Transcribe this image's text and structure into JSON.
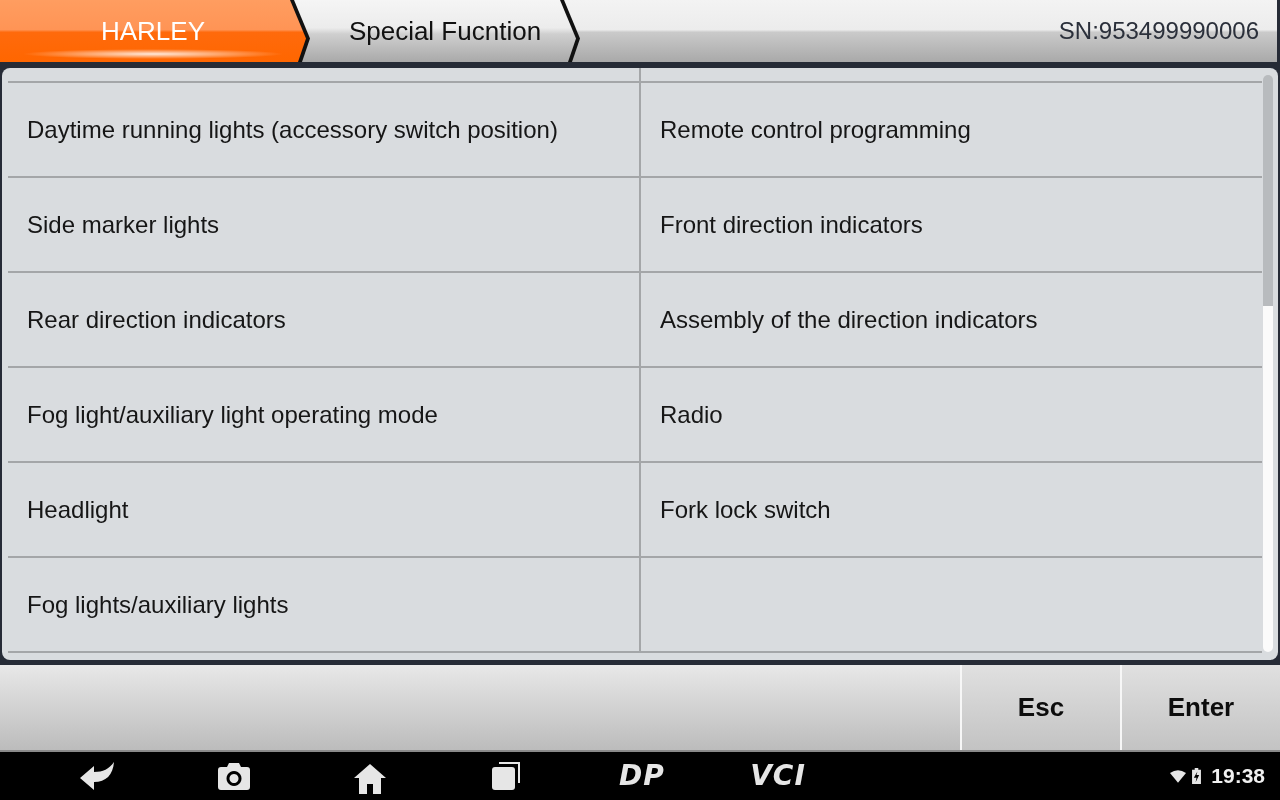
{
  "header": {
    "breadcrumbs": [
      {
        "label": "HARLEY",
        "selected": true
      },
      {
        "label": "Special Fucntion",
        "selected": false
      }
    ],
    "serial": "SN:953499990006"
  },
  "functions": {
    "items": [
      "Daytime running lights (accessory switch position)",
      "Remote control programming",
      "Side marker lights",
      "Front direction indicators",
      "Rear direction indicators",
      "Assembly of the direction indicators",
      "Fog light/auxiliary light operating mode",
      "Radio",
      "Headlight",
      "Fork lock switch",
      "Fog lights/auxiliary lights"
    ]
  },
  "toolbar": {
    "buttons": [
      "Esc",
      "Enter"
    ]
  },
  "nav_bar": {
    "labels": [
      "DP",
      "VCI"
    ],
    "time": "19:38"
  }
}
